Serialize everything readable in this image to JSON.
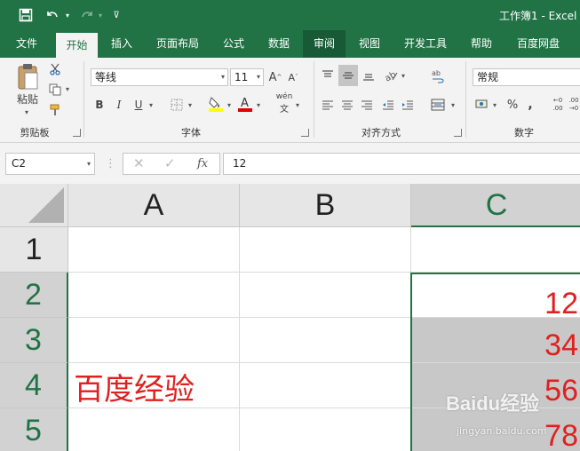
{
  "app": {
    "title": "工作簿1 - Excel",
    "brand_color": "#217346"
  },
  "quick_access": {
    "save_icon": "save-icon",
    "undo_icon": "undo-icon",
    "redo_icon": "redo-icon",
    "customize_icon": "customize-qat-icon"
  },
  "tabs": [
    {
      "label": "文件"
    },
    {
      "label": "开始",
      "active": true
    },
    {
      "label": "插入"
    },
    {
      "label": "页面布局"
    },
    {
      "label": "公式"
    },
    {
      "label": "数据"
    },
    {
      "label": "审阅",
      "hover": true
    },
    {
      "label": "视图"
    },
    {
      "label": "开发工具"
    },
    {
      "label": "帮助"
    },
    {
      "label": "百度网盘"
    }
  ],
  "ribbon": {
    "clipboard": {
      "label": "剪贴板",
      "paste_label": "粘贴"
    },
    "font": {
      "label": "字体",
      "font_name": "等线",
      "font_size": "11",
      "bold": "B",
      "italic": "I",
      "underline": "U",
      "phonetic": "wén"
    },
    "alignment": {
      "label": "对齐方式"
    },
    "number": {
      "label": "数字",
      "format": "常规"
    }
  },
  "formula_bar": {
    "name_box": "C2",
    "value": "12",
    "fx_label": "fx"
  },
  "sheet": {
    "columns": [
      "A",
      "B",
      "C"
    ],
    "rows": [
      "1",
      "2",
      "3",
      "4",
      "5"
    ],
    "cells": {
      "A4": "百度经验",
      "C2": "12",
      "C3": "34",
      "C4": "56",
      "C5": "78"
    },
    "active_cell": "C2",
    "selection": "C2:C5",
    "text_color": "#e02020"
  },
  "watermark": {
    "main": "Baidu经验",
    "sub": "jingyan.baidu.com"
  }
}
